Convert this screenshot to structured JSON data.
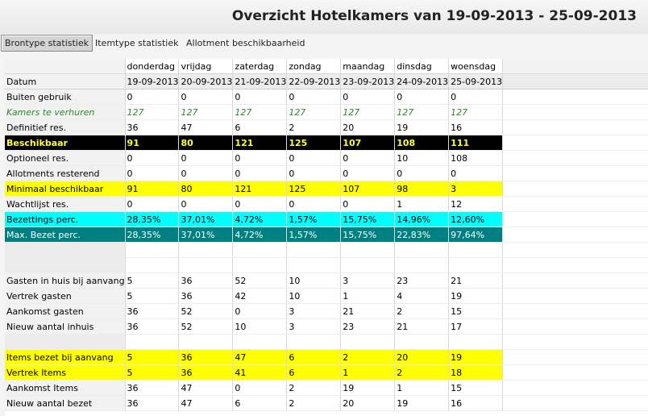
{
  "title": "Overzicht Hotelkamers van 19-09-2013 - 25-09-2013",
  "tabs": [
    "Brontype statistiek",
    "Itemtype statistiek",
    "Allotment beschikbaarheid"
  ],
  "days": [
    "donderdag",
    "vrijdag",
    "zaterdag",
    "zondag",
    "maandag",
    "dinsdag",
    "woensdag"
  ],
  "datum_label": "Datum",
  "dates": [
    "19-09-2013",
    "20-09-2013",
    "21-09-2013",
    "22-09-2013",
    "23-09-2013",
    "24-09-2013",
    "25-09-2013"
  ],
  "rows_top": [
    {
      "label": "Buiten gebruik",
      "values": [
        "0",
        "0",
        "0",
        "0",
        "0",
        "0",
        "0"
      ]
    },
    {
      "label": "Kamers te verhuren",
      "values": [
        "127",
        "127",
        "127",
        "127",
        "127",
        "127",
        "127"
      ]
    },
    {
      "label": "Definitief res.",
      "values": [
        "36",
        "47",
        "6",
        "2",
        "20",
        "19",
        "16"
      ]
    },
    {
      "label": "Beschikbaar",
      "values": [
        "91",
        "80",
        "121",
        "125",
        "107",
        "108",
        "111"
      ]
    },
    {
      "label": "Optioneel res.",
      "values": [
        "0",
        "0",
        "0",
        "0",
        "0",
        "10",
        "108"
      ]
    },
    {
      "label": "Allotments resterend",
      "values": [
        "0",
        "0",
        "0",
        "0",
        "0",
        "0",
        "0"
      ]
    },
    {
      "label": "Minimaal beschikbaar",
      "values": [
        "91",
        "80",
        "121",
        "125",
        "107",
        "98",
        "3"
      ]
    },
    {
      "label": "Wachtlijst res.",
      "values": [
        "0",
        "0",
        "0",
        "0",
        "0",
        "1",
        "12"
      ]
    },
    {
      "label": "Bezettings perc.",
      "values": [
        "28,35%",
        "37,01%",
        "4,72%",
        "1,57%",
        "15,75%",
        "14,96%",
        "12,60%"
      ]
    },
    {
      "label": "Max. Bezet perc.",
      "values": [
        "28,35%",
        "37,01%",
        "4,72%",
        "1,57%",
        "15,75%",
        "22,83%",
        "97,64%"
      ]
    }
  ],
  "rows_guests": [
    {
      "label": "Gasten in huis bij aanvang",
      "values": [
        "5",
        "36",
        "52",
        "10",
        "3",
        "23",
        "21"
      ]
    },
    {
      "label": "Vertrek gasten",
      "values": [
        "5",
        "36",
        "42",
        "10",
        "1",
        "4",
        "19"
      ]
    },
    {
      "label": "Aankomst gasten",
      "values": [
        "36",
        "52",
        "0",
        "3",
        "21",
        "2",
        "15"
      ]
    },
    {
      "label": "Nieuw aantal inhuis",
      "values": [
        "36",
        "52",
        "10",
        "3",
        "23",
        "21",
        "17"
      ]
    }
  ],
  "rows_items": [
    {
      "label": "Items bezet bij aanvang",
      "values": [
        "5",
        "36",
        "47",
        "6",
        "2",
        "20",
        "19"
      ]
    },
    {
      "label": "Vertrek Items",
      "values": [
        "5",
        "36",
        "41",
        "6",
        "1",
        "2",
        "18"
      ]
    },
    {
      "label": "Aankomst Items",
      "values": [
        "36",
        "47",
        "0",
        "2",
        "19",
        "1",
        "15"
      ]
    },
    {
      "label": "Nieuw aantal bezet",
      "values": [
        "36",
        "47",
        "6",
        "2",
        "20",
        "19",
        "16"
      ]
    }
  ],
  "colors": {
    "beschikbaar_bg": "#000000",
    "beschikbaar_fg": "#ffff33",
    "highlight_yellow": "#ffff00",
    "bezettings_cyan": "#00ffff",
    "max_bezet_teal": "#008080",
    "kamers_green": "#2a8a2a"
  }
}
